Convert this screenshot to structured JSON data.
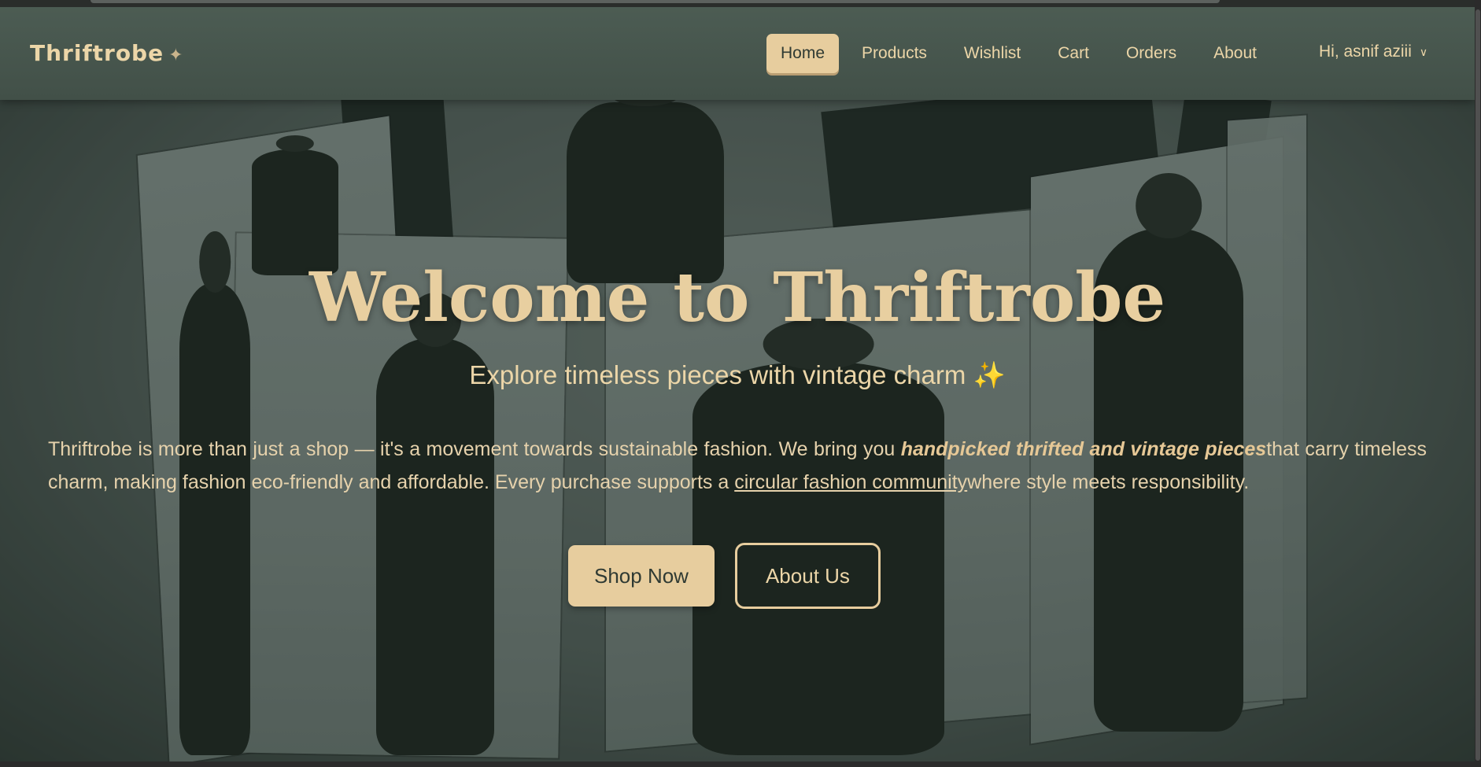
{
  "navbar": {
    "brand": "Thriftrobe",
    "brand_icon": "sparkle-icon",
    "links": [
      "Home",
      "Products",
      "Wishlist",
      "Cart",
      "Orders",
      "About"
    ],
    "active": "Home",
    "user_greeting": "Hi, asnif aziii"
  },
  "hero": {
    "title": "Welcome to Thriftrobe",
    "subtitle": "Explore timeless pieces with vintage charm ✨",
    "desc_1": "Thriftrobe is more than just a shop — it's a movement towards sustainable fashion. We bring you ",
    "desc_emphasis": "handpicked thrifted and vintage pieces",
    "desc_2": "that carry timeless charm, making fashion eco-friendly and affordable. Every purchase supports a ",
    "desc_link": "circular fashion community",
    "desc_3": "where style meets responsibility.",
    "primary_button": "Shop Now",
    "secondary_button": "About Us"
  },
  "colors": {
    "accent": "#e7cd9e",
    "navbar": "#4c5c53",
    "background": "#243029"
  }
}
